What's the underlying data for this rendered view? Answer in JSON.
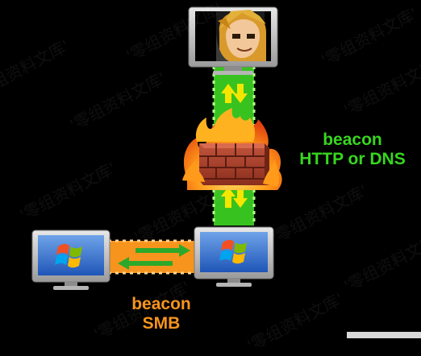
{
  "labels": {
    "http_beacon": "beacon",
    "http_protocol": "HTTP or DNS",
    "smb_beacon": "beacon",
    "smb_protocol": "SMB"
  },
  "watermark": "'零组资料文库'",
  "icons": {
    "top_computer": "monitor-with-avatar-icon",
    "firewall": "burning-brick-firewall-icon",
    "pivot_computer": "windows-monitor-icon",
    "left_computer": "windows-monitor-icon"
  },
  "colors": {
    "background": "#000000",
    "http_channel": "#38c21f",
    "smb_channel": "#f7941d",
    "arrows": "#f5e600",
    "http_text": "#37d61f",
    "smb_text": "#f7941d"
  }
}
